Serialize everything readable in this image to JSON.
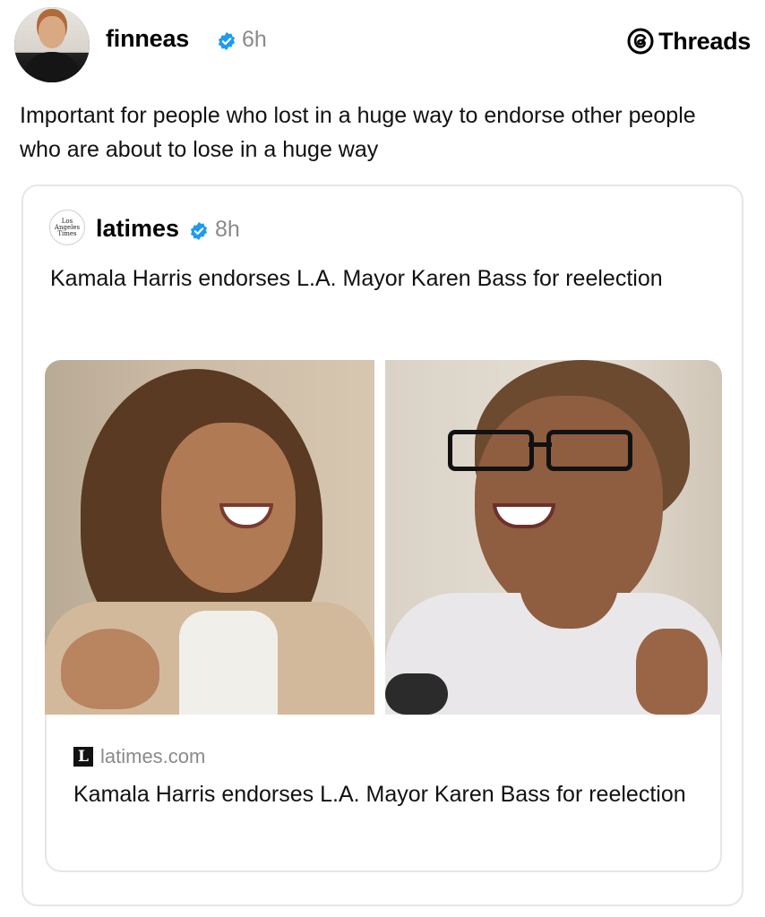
{
  "post": {
    "username": "finneas",
    "time": "6h",
    "text": "Important for people who lost in a huge way to endorse other people who are about to lose in a huge way"
  },
  "app": {
    "name": "Threads",
    "mark_icon": "threads-logo-icon"
  },
  "quoted_post": {
    "username": "latimes",
    "time": "8h",
    "text": "Kamala Harris endorses L.A. Mayor Karen Bass for reelection",
    "avatar_text": "Los Angeles Times"
  },
  "link_preview": {
    "domain": "latimes.com",
    "favicon_letter": "L",
    "title": "Kamala Harris endorses L.A. Mayor Karen Bass for reelection"
  },
  "colors": {
    "verified": "#1d9bf0",
    "meta_text": "#8a8a8a",
    "border": "#e6e6e6"
  }
}
